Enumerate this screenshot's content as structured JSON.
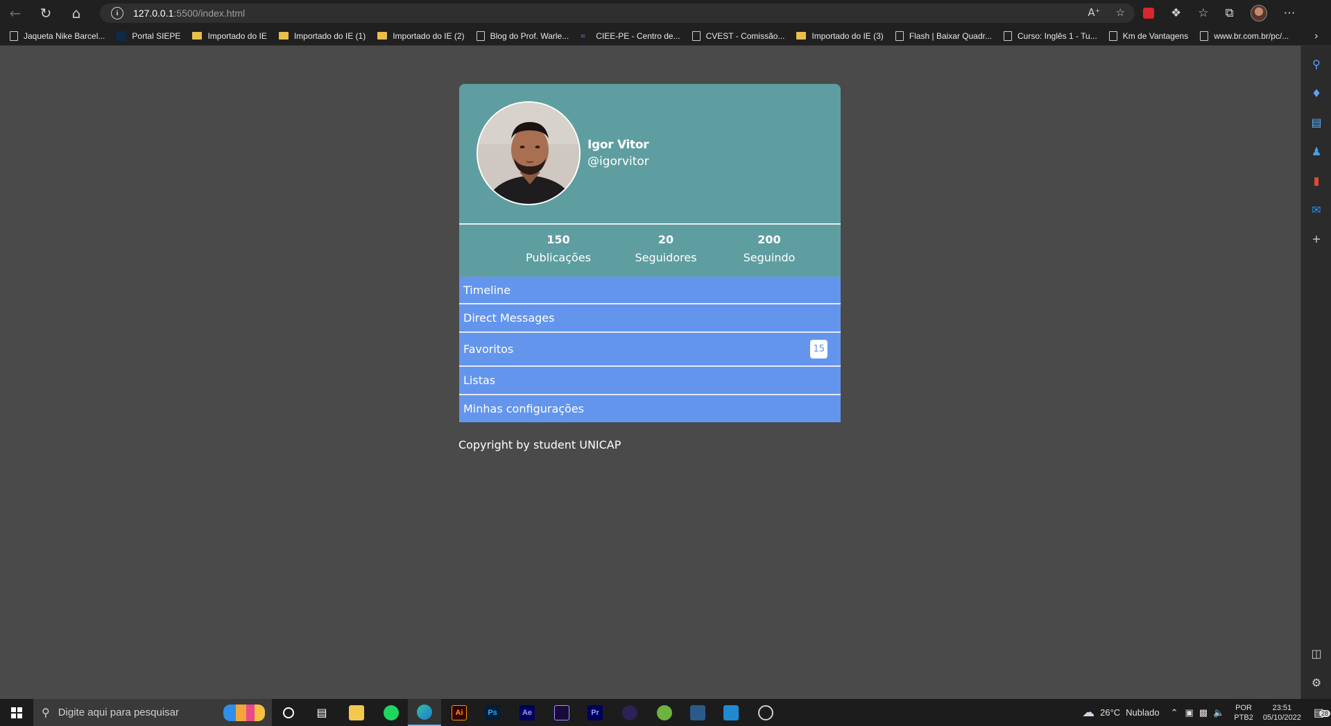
{
  "browser": {
    "url_host": "127.0.0.1",
    "url_path": ":5500/index.html",
    "bookmarks": [
      {
        "label": "Jaqueta Nike Barcel...",
        "icon": "page-icon"
      },
      {
        "label": "Portal SIEPE",
        "icon": "siepe-icon"
      },
      {
        "label": "Importado do IE",
        "icon": "folder-icon"
      },
      {
        "label": "Importado do IE (1)",
        "icon": "folder-icon"
      },
      {
        "label": "Importado do IE (2)",
        "icon": "folder-icon"
      },
      {
        "label": "Blog do Prof. Warle...",
        "icon": "page-icon"
      },
      {
        "label": "CIEE-PE - Centro de...",
        "icon": "ciee-icon"
      },
      {
        "label": "CVEST - Comissão...",
        "icon": "page-icon"
      },
      {
        "label": "Importado do IE (3)",
        "icon": "folder-icon"
      },
      {
        "label": "Flash | Baixar Quadr...",
        "icon": "page-icon"
      },
      {
        "label": "Curso: Inglês 1 - Tu...",
        "icon": "page-icon"
      },
      {
        "label": "Km de Vantagens",
        "icon": "page-icon"
      },
      {
        "label": "www.br.com.br/pc/...",
        "icon": "page-icon"
      }
    ]
  },
  "profile": {
    "name": "Igor Vitor",
    "handle": "@igorvitor"
  },
  "stats": [
    {
      "value": "150",
      "label": "Publicações"
    },
    {
      "value": "20",
      "label": "Seguidores"
    },
    {
      "value": "200",
      "label": "Seguindo"
    }
  ],
  "menu": [
    {
      "label": "Timeline"
    },
    {
      "label": "Direct Messages"
    },
    {
      "label": "Favoritos",
      "badge": "15"
    },
    {
      "label": "Listas"
    },
    {
      "label": "Minhas configurações"
    }
  ],
  "footer": {
    "copyright": "Copyright by student UNICAP"
  },
  "taskbar": {
    "search_placeholder": "Digite aqui para pesquisar",
    "weather_temp": "26°C",
    "weather_desc": "Nublado",
    "lang_top": "POR",
    "lang_bottom": "PTB2",
    "time": "23:51",
    "date": "05/10/2022",
    "notifications": "28"
  },
  "colors": {
    "profile_bg": "#5f9ea0",
    "menu_bg": "#6495ed",
    "page_bg": "#4a4a4a"
  }
}
